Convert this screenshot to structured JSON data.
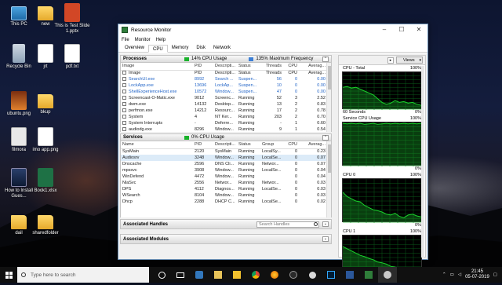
{
  "desktop_icons": [
    {
      "label": "This PC",
      "kind": "pc"
    },
    {
      "label": "new",
      "kind": "folder"
    },
    {
      "label": "This is Test Slide 1.pptx",
      "kind": "ppt"
    },
    {
      "label": "Recycle Bin",
      "kind": "bin"
    },
    {
      "label": "jrt",
      "kind": "doc"
    },
    {
      "label": "pdf.txt",
      "kind": "pdf"
    },
    {
      "label": "ubuntu.png",
      "kind": "png"
    },
    {
      "label": "bkup",
      "kind": "folder"
    },
    {
      "label": "filmora",
      "kind": "filmora"
    },
    {
      "label": "imo app.png",
      "kind": "dell"
    },
    {
      "label": "How to Install Gues...",
      "kind": "gues"
    },
    {
      "label": "Book1.xlsx",
      "kind": "xlsx"
    },
    {
      "label": "dail",
      "kind": "folder"
    },
    {
      "label": "sharedfolder",
      "kind": "folder"
    }
  ],
  "window": {
    "title": "Resource Monitor",
    "menu": [
      "File",
      "Monitor",
      "Help"
    ],
    "tabs": [
      "Overview",
      "CPU",
      "Memory",
      "Disk",
      "Network"
    ],
    "active_tab": "CPU"
  },
  "processes": {
    "title": "Processes",
    "meter1": "14% CPU Usage",
    "meter2": "135% Maximum Frequency",
    "columns": [
      "Image",
      "PID",
      "Descripti...",
      "Status",
      "Threads",
      "CPU",
      "Averag..."
    ],
    "rows": [
      [
        "Image",
        "PID",
        "Descripti...",
        "Status",
        "Threads",
        "CPU",
        "Averag..."
      ],
      [
        "SearchUI.exe",
        "8992",
        "Search ...",
        "Suspen...",
        "56",
        "0",
        "0.00"
      ],
      [
        "LockApp.exe",
        "13696",
        "LockAp...",
        "Suspen...",
        "10",
        "0",
        "0.00"
      ],
      [
        "ShellExperienceHost.exe",
        "10572",
        "Window...",
        "Suspen...",
        "47",
        "0",
        "0.00"
      ],
      [
        "Screencast-O-Matic.exe",
        "9012",
        "Screenc...",
        "Running",
        "52",
        "3",
        "2.52"
      ],
      [
        "dwm.exe",
        "14132",
        "Desktop...",
        "Running",
        "13",
        "2",
        "0.83"
      ],
      [
        "perfmon.exe",
        "14212",
        "Resourc...",
        "Running",
        "17",
        "2",
        "0.78"
      ],
      [
        "System",
        "4",
        "NT Ker...",
        "Running",
        "203",
        "2",
        "0.70"
      ],
      [
        "System Interrupts",
        "-",
        "Deferre...",
        "Running",
        "-",
        "1",
        "0.60"
      ],
      [
        "audiodg.exe",
        "8296",
        "Window...",
        "Running",
        "9",
        "1",
        "0.54"
      ]
    ],
    "blue_rows": [
      1,
      2,
      3
    ]
  },
  "services": {
    "title": "Services",
    "meter1": "0% CPU Usage",
    "columns": [
      "Name",
      "PID",
      "Descripti...",
      "Status",
      "Group",
      "CPU",
      "Averag..."
    ],
    "rows": [
      [
        "SysMain",
        "2120",
        "SysMain",
        "Running",
        "LocalSy...",
        "0",
        "0.23"
      ],
      [
        "Audiosrv",
        "3248",
        "Window...",
        "Running",
        "LocalSe...",
        "0",
        "0.07"
      ],
      [
        "Dnscache",
        "2596",
        "DNS Cli...",
        "Running",
        "Networ...",
        "0",
        "0.07"
      ],
      [
        "mpssvc",
        "3908",
        "Window...",
        "Running",
        "LocalSe...",
        "0",
        "0.04"
      ],
      [
        "WinDefend",
        "4472",
        "Window...",
        "Running",
        "",
        "0",
        "0.04"
      ],
      [
        "NlaSvc",
        "2556",
        "Networ...",
        "Running",
        "Networ...",
        "0",
        "0.03"
      ],
      [
        "DPS",
        "4112",
        "Diagnos...",
        "Running",
        "LocalSe...",
        "0",
        "0.03"
      ],
      [
        "WSearch",
        "8104",
        "Window...",
        "Running",
        "",
        "0",
        "0.03"
      ],
      [
        "Dhcp",
        "2288",
        "DHCP C...",
        "Running",
        "LocalSe...",
        "0",
        "0.02"
      ]
    ]
  },
  "associated_handles": {
    "title": "Associated Handles",
    "search_placeholder": "Search Handles"
  },
  "associated_modules": {
    "title": "Associated Modules"
  },
  "right_pane": {
    "views_label": "Views",
    "graphs": [
      {
        "left": "CPU - Total",
        "right": "100%",
        "bottom_left": "60 Seconds",
        "bottom_right": "0%"
      },
      {
        "left": "Service CPU Usage",
        "right": "100%",
        "bottom_left": "",
        "bottom_right": "0%"
      },
      {
        "left": "CPU 0",
        "right": "100%",
        "bottom_left": "",
        "bottom_right": "0%"
      },
      {
        "left": "CPU 1",
        "right": "100%",
        "bottom_left": "",
        "bottom_right": ""
      }
    ]
  },
  "taskbar": {
    "search_placeholder": "Type here to search",
    "time": "21:45",
    "date": "05-07-2019"
  }
}
